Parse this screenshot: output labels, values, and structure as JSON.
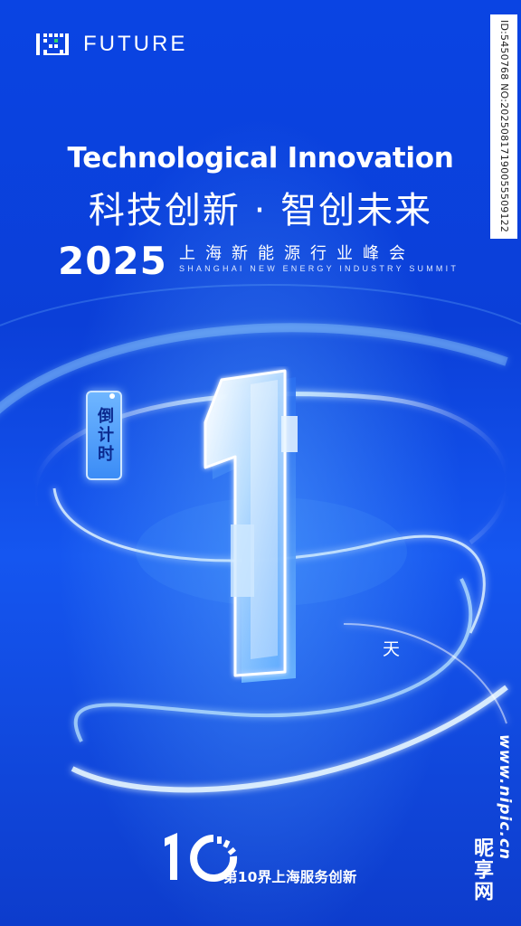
{
  "brand": {
    "logo_text": "FUTURE",
    "logo_icon": "pixel-grid-logo"
  },
  "watermark": {
    "id_text": "ID:5450768 NO:20250817190055509122",
    "site_url": "www.nipic.cn",
    "site_brand": "昵享网"
  },
  "headline": {
    "title_en": "Technological Innovation",
    "title_cn": "科技创新 · 智创未来"
  },
  "event": {
    "year": "2025",
    "name_cn": "上海新能源行业峰会",
    "name_en": "SHANGHAI NEW ENERGY INDUSTRY SUMMIT"
  },
  "countdown": {
    "badge_label": "倒计时",
    "days": 1,
    "days_display": "1",
    "unit": "天"
  },
  "edition": {
    "number": "10",
    "text": "第10界上海服务创新"
  },
  "colors": {
    "background": "#0b3fd8",
    "accent": "#ffffff",
    "highlight_glow": "#8fd3ff",
    "logo_green": "#2fd46a"
  }
}
